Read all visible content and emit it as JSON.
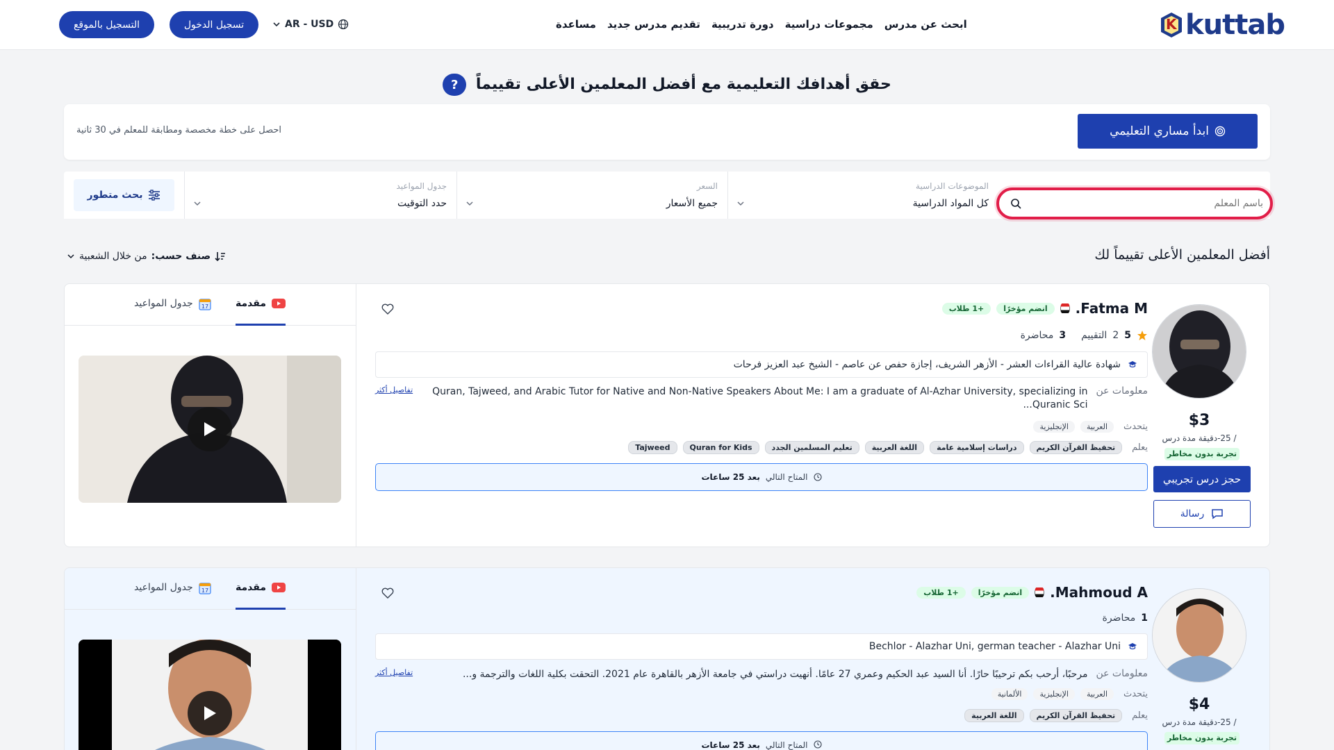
{
  "header": {
    "logo_text": "kuttab",
    "logo_letter": "K",
    "nav": [
      "ابحث عن مدرس",
      "مجموعات دراسية",
      "دورة تدريبية",
      "تقديم مدرس جديد",
      "مساعدة"
    ],
    "locale": "AR - USD",
    "login_label": "تسجيل الدخول",
    "register_label": "التسجيل بالموقع",
    "brand_color": "#1e40af"
  },
  "hero": {
    "title": "حقق أهدافك التعليمية مع أفضل المعلمين الأعلى تقييماً",
    "q_mark": "?",
    "plan_button": "ابدأ مساري التعليمي",
    "plan_text": "احصل على خطة مخصصة ومطابقة للمعلم في 30 ثانية"
  },
  "filters": {
    "search_placeholder": "باسم المعلم",
    "subjects_label": "الموضوعات الدراسية",
    "subjects_value": "كل المواد الدراسية",
    "price_label": "السعر",
    "price_value": "جميع الأسعار",
    "schedule_label": "جدول المواعيد",
    "schedule_value": "حدد التوقيت",
    "advanced_label": "بحث متطور"
  },
  "results": {
    "title": "أفضل المعلمين الأعلى تقييماً لك",
    "sort_label": "صنف حسب:",
    "sort_value": "من خلال الشعبية"
  },
  "teachers": [
    {
      "name": "Fatma M.",
      "flag_icon": "egypt-flag-icon",
      "joined_badge": "انضم مؤخرًا",
      "students_badge": "+1 طلاب",
      "rating": "5",
      "reviews_count": "2",
      "reviews_label": "التقييم",
      "lectures_count": "3",
      "lectures_label": "محاضرة",
      "certificate": "شهادة عالية القراءات العشر - الأزهر الشريف، إجازة حفص عن عاصم - الشيخ عبد العزيز فرحات",
      "about_label": "معلومات عن",
      "about_text": "Quran, Tajweed, and Arabic Tutor for Native and Non-Native Speakers About Me: I am a graduate of Al-Azhar University, specializing in Quranic Sci...",
      "more_label": "تفاصيل أكثر",
      "speaks_label": "يتحدث",
      "speaks": [
        "العربية",
        "الإنجليزية"
      ],
      "teaches_label": "يعلم",
      "teaches": [
        "تحفيظ القرآن الكريم",
        "دراسات إسلامية عامة",
        "اللغة العربية",
        "تعليم المسلمين الجدد",
        "Quran for Kids",
        "Tajweed"
      ],
      "price": "$3",
      "price_sub": "/ 25-دقيقة مدة درس",
      "trial_tag": "تجربة بدون مخاطر",
      "book_label": "حجز درس تجريبي",
      "message_label": "رسالة",
      "next_label": "المتاح التالي",
      "next_value": "بعد 25 ساعات",
      "tab_intro": "مقدمة",
      "tab_schedule": "جدول المواعيد"
    },
    {
      "name": "Mahmoud A.",
      "flag_icon": "egypt-flag-icon",
      "joined_badge": "انضم مؤخرًا",
      "students_badge": "+1 طلاب",
      "lectures_count": "1",
      "lectures_label": "محاضرة",
      "certificate": "Bechlor - Alazhar Uni, german teacher - Alazhar Uni",
      "about_label": "معلومات عن",
      "about_text": "مرحبًا، أرحب بكم ترحيبًا حارًا. أنا السيد عبد الحكيم وعمري 27 عامًا. أنهيت دراستي في جامعة الأزهر بالقاهرة عام 2021. التحقت بكلية اللغات والترجمة و...",
      "more_label": "تفاصيل أكثر",
      "speaks_label": "يتحدث",
      "speaks": [
        "العربية",
        "الإنجليزية",
        "الألمانية"
      ],
      "teaches_label": "يعلم",
      "teaches": [
        "تحفيظ القرآن الكريم",
        "اللغة العربية"
      ],
      "price": "$4",
      "price_sub": "/ 25-دقيقة مدة درس",
      "trial_tag": "تجربة بدون مخاطر",
      "next_label": "المتاح التالي",
      "next_value": "بعد 25 ساعات",
      "tab_intro": "مقدمة",
      "tab_schedule": "جدول المواعيد"
    }
  ]
}
